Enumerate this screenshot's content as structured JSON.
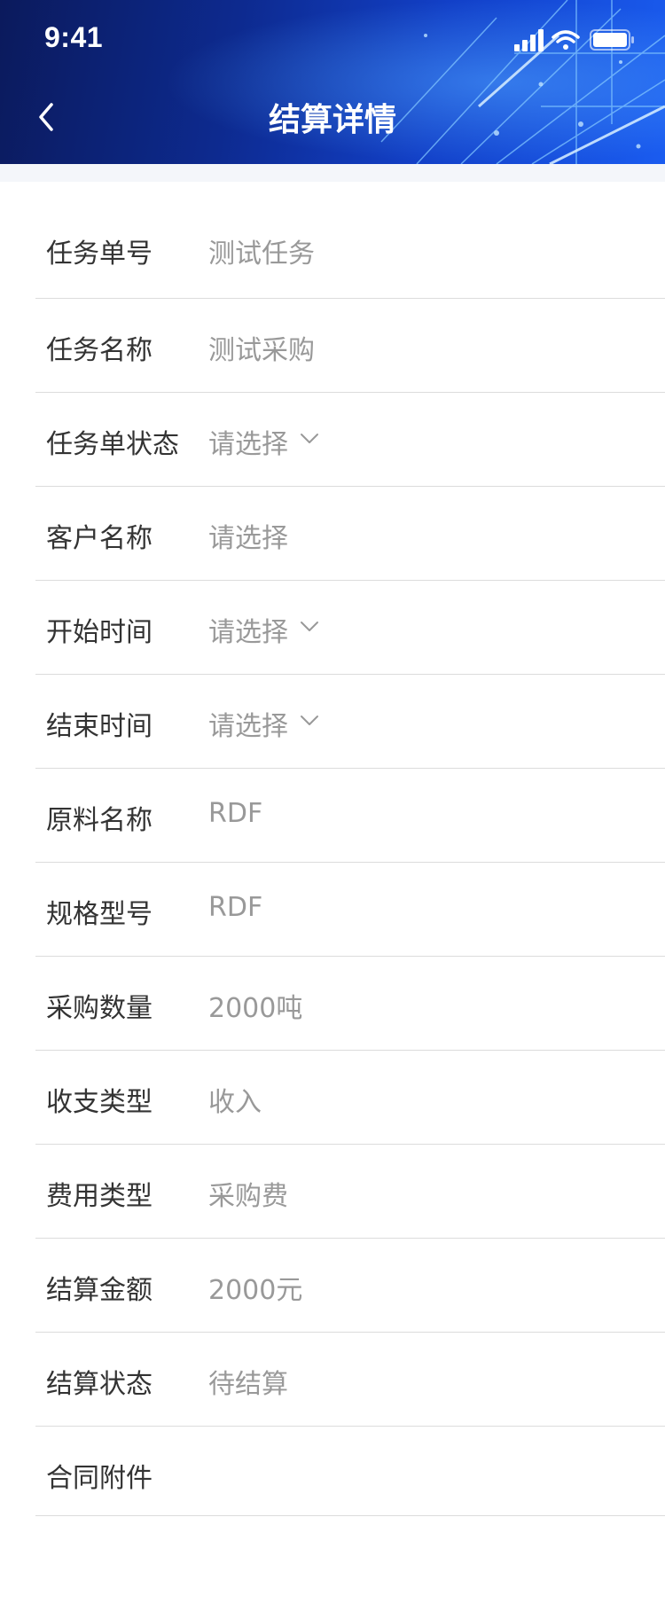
{
  "status_bar": {
    "time": "9:41"
  },
  "header": {
    "title": "结算详情",
    "back_icon": "chevron-left-icon"
  },
  "form": {
    "rows": [
      {
        "label": "任务单号",
        "value": "测试任务",
        "dropdown": false
      },
      {
        "label": "任务名称",
        "value": "测试采购",
        "dropdown": false
      },
      {
        "label": "任务单状态",
        "value": "请选择",
        "dropdown": true
      },
      {
        "label": "客户名称",
        "value": "请选择",
        "dropdown": false
      },
      {
        "label": "开始时间",
        "value": "请选择",
        "dropdown": true
      },
      {
        "label": "结束时间",
        "value": "请选择",
        "dropdown": true
      },
      {
        "label": "原料名称",
        "value": "RDF",
        "dropdown": false
      },
      {
        "label": "规格型号",
        "value": "RDF",
        "dropdown": false
      },
      {
        "label": "采购数量",
        "value": "2000吨",
        "dropdown": false
      },
      {
        "label": "收支类型",
        "value": "收入",
        "dropdown": false
      },
      {
        "label": "费用类型",
        "value": "采购费",
        "dropdown": false
      },
      {
        "label": "结算金额",
        "value": "2000元",
        "dropdown": false
      },
      {
        "label": "结算状态",
        "value": "待结算",
        "dropdown": false
      },
      {
        "label": "合同附件",
        "value": "",
        "dropdown": false
      }
    ]
  },
  "colors": {
    "label": "#333333",
    "value": "#999999",
    "header_dark": "#0b1a5c",
    "header_light": "#1a5cf0",
    "divider": "#dcdcdc"
  }
}
